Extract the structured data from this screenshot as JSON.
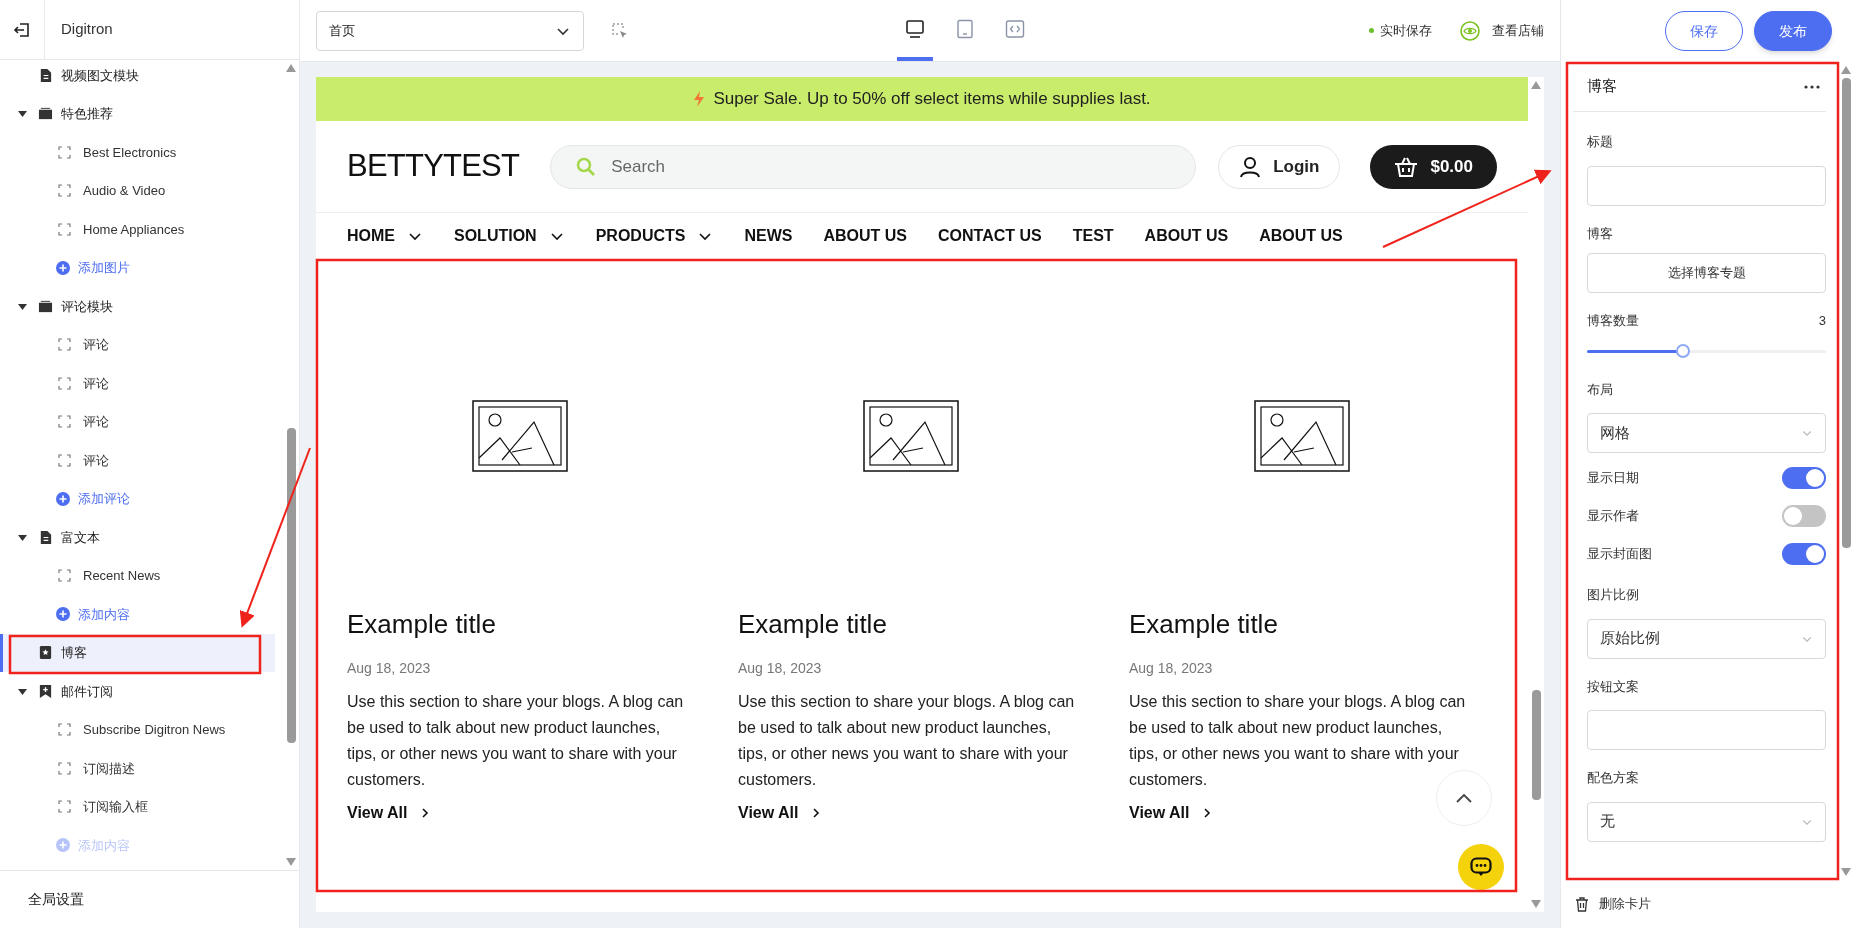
{
  "sidebar": {
    "title": "Digitron",
    "tree": [
      {
        "label": "视频图文模块",
        "kind": "document",
        "selected": false
      },
      {
        "label": "特色推荐",
        "kind": "folder",
        "expanded": true,
        "selected": false,
        "children": [
          {
            "label": "Best Electronics",
            "kind": "block",
            "selected": false
          },
          {
            "label": "Audio & Video",
            "kind": "block",
            "selected": false
          },
          {
            "label": "Home Appliances",
            "kind": "block",
            "selected": false
          },
          {
            "label": "添加图片",
            "kind": "add",
            "disabled": false
          }
        ]
      },
      {
        "label": "评论模块",
        "kind": "folder",
        "expanded": true,
        "selected": false,
        "children": [
          {
            "label": "评论",
            "kind": "block",
            "selected": false
          },
          {
            "label": "评论",
            "kind": "block",
            "selected": false
          },
          {
            "label": "评论",
            "kind": "block",
            "selected": false
          },
          {
            "label": "评论",
            "kind": "block",
            "selected": false
          },
          {
            "label": "添加评论",
            "kind": "add",
            "disabled": false
          }
        ]
      },
      {
        "label": "富文本",
        "kind": "document",
        "expanded": true,
        "selected": false,
        "children": [
          {
            "label": "Recent News",
            "kind": "block",
            "selected": false
          },
          {
            "label": "添加内容",
            "kind": "add",
            "disabled": false
          }
        ]
      },
      {
        "label": "博客",
        "kind": "blog",
        "selected": true
      },
      {
        "label": "邮件订阅",
        "kind": "subscribe",
        "expanded": true,
        "selected": false,
        "children": [
          {
            "label": "Subscribe Digitron News",
            "kind": "block",
            "selected": false
          },
          {
            "label": "订阅描述",
            "kind": "block",
            "selected": false
          },
          {
            "label": "订阅输入框",
            "kind": "block",
            "selected": false
          },
          {
            "label": "添加内容",
            "kind": "add",
            "disabled": true
          }
        ]
      }
    ],
    "footer": "全局设置"
  },
  "topbar": {
    "page_select": "首页",
    "devices": [
      {
        "kind": "desktop",
        "selected": true
      },
      {
        "kind": "tablet",
        "selected": false
      },
      {
        "kind": "fullwidth",
        "selected": false
      }
    ],
    "autosave": "实时保存",
    "view_store": "查看店铺"
  },
  "actions": [
    {
      "label": "保存",
      "kind": "outline"
    },
    {
      "label": "发布",
      "kind": "primary"
    }
  ],
  "preview": {
    "banner": "Super Sale. Up to 50% off select items while supplies last.",
    "logo": "BETTYTEST",
    "search": {
      "placeholder": "Search"
    },
    "login": "Login",
    "cart": "$0.00",
    "nav": [
      {
        "label": "HOME",
        "dropdown": true
      },
      {
        "label": "SOLUTION",
        "dropdown": true
      },
      {
        "label": "PRODUCTS",
        "dropdown": true
      },
      {
        "label": "NEWS",
        "dropdown": false
      },
      {
        "label": "ABOUT US",
        "dropdown": false
      },
      {
        "label": "CONTACT US",
        "dropdown": false
      },
      {
        "label": "TEST",
        "dropdown": false
      },
      {
        "label": "ABOUT US",
        "dropdown": false
      },
      {
        "label": "ABOUT US",
        "dropdown": false
      }
    ],
    "posts": [
      {
        "title": "Example title",
        "date": "Aug 18, 2023",
        "excerpt": "Use this section to share your blogs. A blog can be used to talk about new product launches, tips, or other news you want to share with your customers.",
        "link": "View All"
      },
      {
        "title": "Example title",
        "date": "Aug 18, 2023",
        "excerpt": "Use this section to share your blogs. A blog can be used to talk about new product launches, tips, or other news you want to share with your customers.",
        "link": "View All"
      },
      {
        "title": "Example title",
        "date": "Aug 18, 2023",
        "excerpt": "Use this section to share your blogs. A blog can be used to talk about new product launches, tips, or other news you want to share with your customers.",
        "link": "View All"
      }
    ]
  },
  "panel": {
    "title": "博客",
    "fields": [
      {
        "kind": "input",
        "label": "标题"
      },
      {
        "kind": "button",
        "label": "博客",
        "text": "选择博客专题"
      },
      {
        "kind": "slider",
        "label": "博客数量",
        "value": "3",
        "level": 0.4
      },
      {
        "kind": "select",
        "label": "布局",
        "value": "网格"
      },
      {
        "kind": "toggle",
        "label": "显示日期",
        "on": true
      },
      {
        "kind": "toggle",
        "label": "显示作者",
        "on": false
      },
      {
        "kind": "toggle",
        "label": "显示封面图",
        "on": true
      },
      {
        "kind": "select",
        "label": "图片比例",
        "value": "原始比例"
      },
      {
        "kind": "input",
        "label": "按钮文案"
      },
      {
        "kind": "select",
        "label": "配色方案",
        "value": "无"
      }
    ],
    "delete": "删除卡片"
  }
}
